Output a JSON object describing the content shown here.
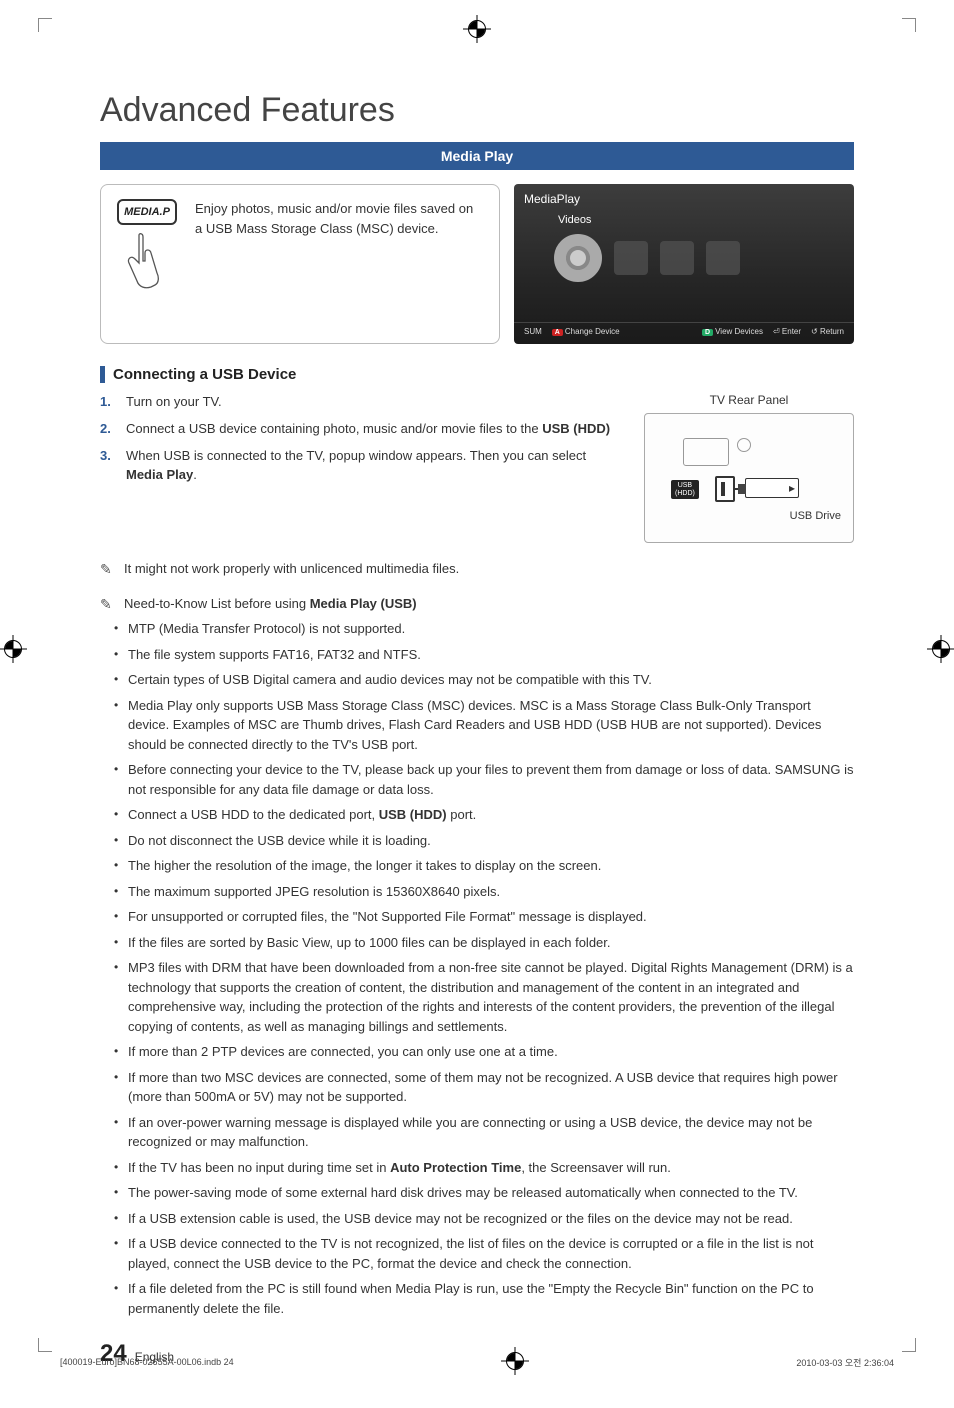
{
  "page_title": "Advanced Features",
  "section_bar": "Media Play",
  "remote_button_label": "MEDIA.P",
  "intro_text": "Enjoy photos, music and/or movie files saved on a USB Mass Storage Class (MSC) device.",
  "tv": {
    "title": "MediaPlay",
    "category": "Videos",
    "footer_sum": "SUM",
    "footer_change": "Change Device",
    "footer_view": "View Devices",
    "footer_enter": "Enter",
    "footer_return": "Return"
  },
  "subheading": "Connecting a USB Device",
  "steps": {
    "s1": "Turn on your TV.",
    "s2_a": "Connect a USB device containing photo, music and/or movie files to the ",
    "s2_b": "USB (HDD)",
    "s3_a": "When USB is connected to the TV, popup window appears. Then you can select ",
    "s3_b": "Media Play",
    "s3_c": "."
  },
  "rear_panel": {
    "caption": "TV Rear Panel",
    "usb_label": "USB\n(HDD)",
    "drive_label": "USB Drive"
  },
  "note1": "It might not work properly with unlicenced multimedia files.",
  "note2_a": "Need-to-Know List before using ",
  "note2_b": "Media Play (USB)",
  "bullets": {
    "b1": "MTP (Media Transfer Protocol) is not supported.",
    "b2": "The file system supports FAT16, FAT32 and NTFS.",
    "b3": "Certain types of USB Digital camera and audio devices may not be compatible with this TV.",
    "b4": "Media Play only supports USB Mass Storage Class (MSC) devices. MSC is a Mass Storage Class Bulk-Only Transport device. Examples of MSC are Thumb drives, Flash Card Readers and USB HDD (USB HUB are not supported). Devices should be connected directly to the TV's USB port.",
    "b5": "Before connecting your device to the TV, please back up your files to prevent them from damage or loss of data. SAMSUNG is not responsible for any data file damage or data loss.",
    "b6_a": "Connect a USB HDD to the dedicated port, ",
    "b6_b": "USB (HDD)",
    "b6_c": " port.",
    "b7": "Do not disconnect the USB device while it is loading.",
    "b8": "The higher the resolution of the image, the longer it takes to display on the screen.",
    "b9": "The maximum supported JPEG resolution is 15360X8640 pixels.",
    "b10": "For unsupported or corrupted files, the \"Not Supported File Format\" message is displayed.",
    "b11": "If the files are sorted by Basic View, up to 1000 files can be displayed in each folder.",
    "b12": "MP3 files with DRM that have been downloaded from a non-free site cannot be played. Digital Rights Management (DRM) is a technology that supports the creation of content, the distribution and management of the content in an integrated and comprehensive way, including the protection of the rights and interests of the content providers, the prevention of the illegal copying of contents, as well as managing billings and settlements.",
    "b13": "If more than 2 PTP devices are connected, you can only use one at a time.",
    "b14": "If more than two MSC devices are connected, some of them may not be recognized. A USB device that requires high power (more than 500mA or 5V) may not be supported.",
    "b15": "If an over-power warning message is displayed while you are connecting or using a USB device, the device may not be recognized or may malfunction.",
    "b16_a": "If the TV has been no input during time set in ",
    "b16_b": "Auto Protection Time",
    "b16_c": ", the Screensaver will run.",
    "b17": "The power-saving mode of some external hard disk drives may be released automatically when connected to the TV.",
    "b18": "If a USB extension cable is used, the USB device may not be recognized or the files on the device may not be read.",
    "b19": "If a USB device connected to the TV is not recognized, the list of files on the device is corrupted or a file in the list is not played, connect the USB device to the PC, format the device and check the connection.",
    "b20": "If a file deleted from the PC is still found when Media Play is run, use the \"Empty the Recycle Bin\" function on the PC to permanently delete the file."
  },
  "page_number": "24",
  "page_lang": "English",
  "footer_left": "[400019-Euro]BN68-02655A-00L06.indb   24",
  "footer_right": "2010-03-03   오전 2:36:04"
}
